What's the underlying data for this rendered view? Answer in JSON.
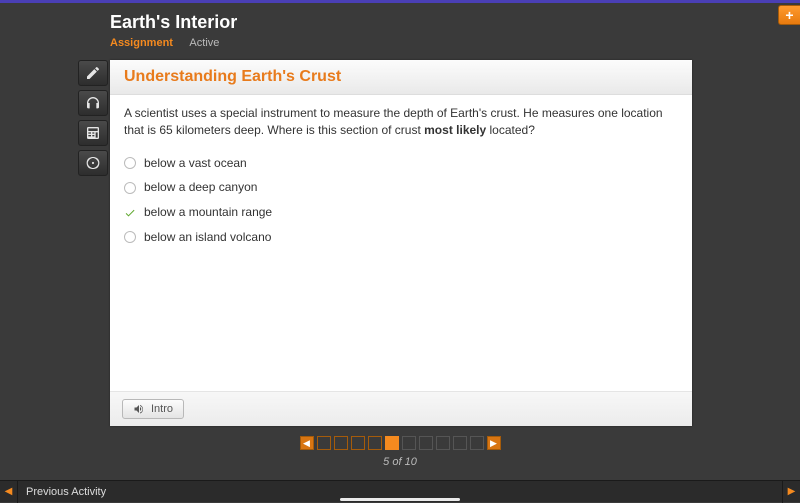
{
  "header": {
    "title": "Earth's Interior",
    "assignment_label": "Assignment",
    "status_label": "Active"
  },
  "question": {
    "title": "Understanding Earth's Crust",
    "text_before_bold": "A scientist uses a special instrument to measure the depth of Earth's crust. He measures one location that is 65 kilometers deep. Where is this section of crust ",
    "bold": "most likely",
    "text_after_bold": " located?",
    "choices": [
      "below a vast ocean",
      "below a deep canyon",
      "below a mountain range",
      "below an island volcano"
    ],
    "selected_index": 2
  },
  "intro_label": "Intro",
  "pager": {
    "current": 5,
    "total": 10,
    "status": "5 of 10"
  },
  "bottombar": {
    "prev": "Previous Activity"
  },
  "colors": {
    "accent": "#f58a1f"
  }
}
